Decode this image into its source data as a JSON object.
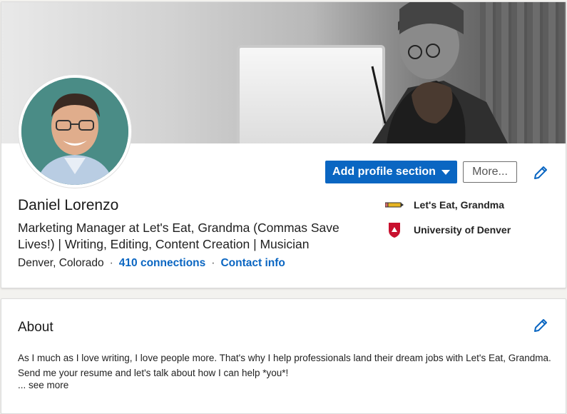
{
  "profile": {
    "name": "Daniel Lorenzo",
    "headline": "Marketing Manager at Let's Eat, Grandma (Commas Save Lives!) | Writing, Editing, Content Creation | Musician",
    "location": "Denver, Colorado",
    "connections": "410 connections",
    "contact_info": "Contact info"
  },
  "actions": {
    "add_section": "Add profile section",
    "more": "More..."
  },
  "sidebar": {
    "company": "Let's Eat, Grandma",
    "school": "University of Denver"
  },
  "about": {
    "title": "About",
    "text": "As I much as I love writing, I love people more. That's why I help professionals land their dream jobs with Let's Eat, Grandma. Send me your resume and let's talk about how I can help *you*!",
    "see_more": "... see more"
  },
  "colors": {
    "accent": "#0a66c2",
    "school_logo": "#c8102e",
    "company_logo": "#e6b422"
  },
  "icons": [
    "pencil-icon",
    "caret-down-icon",
    "pencil-logo-icon",
    "university-shield-icon"
  ]
}
